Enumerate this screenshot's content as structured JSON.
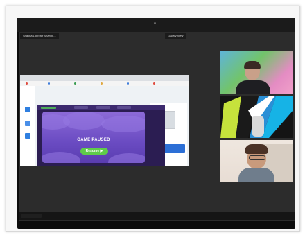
{
  "meeting": {
    "shared_label": "Shayna Loeb for Sharing...",
    "view_label": "Gallery View"
  },
  "game": {
    "pause_title": "GAME PAUSED",
    "resume_label": "Resume ▶"
  },
  "colors": {
    "resume_button": "#5fcb4a",
    "pause_panel": "#7a59cc",
    "banner": "#2c6fd6"
  },
  "icons": [
    "camera-icon",
    "shield-icon",
    "play-icon"
  ]
}
